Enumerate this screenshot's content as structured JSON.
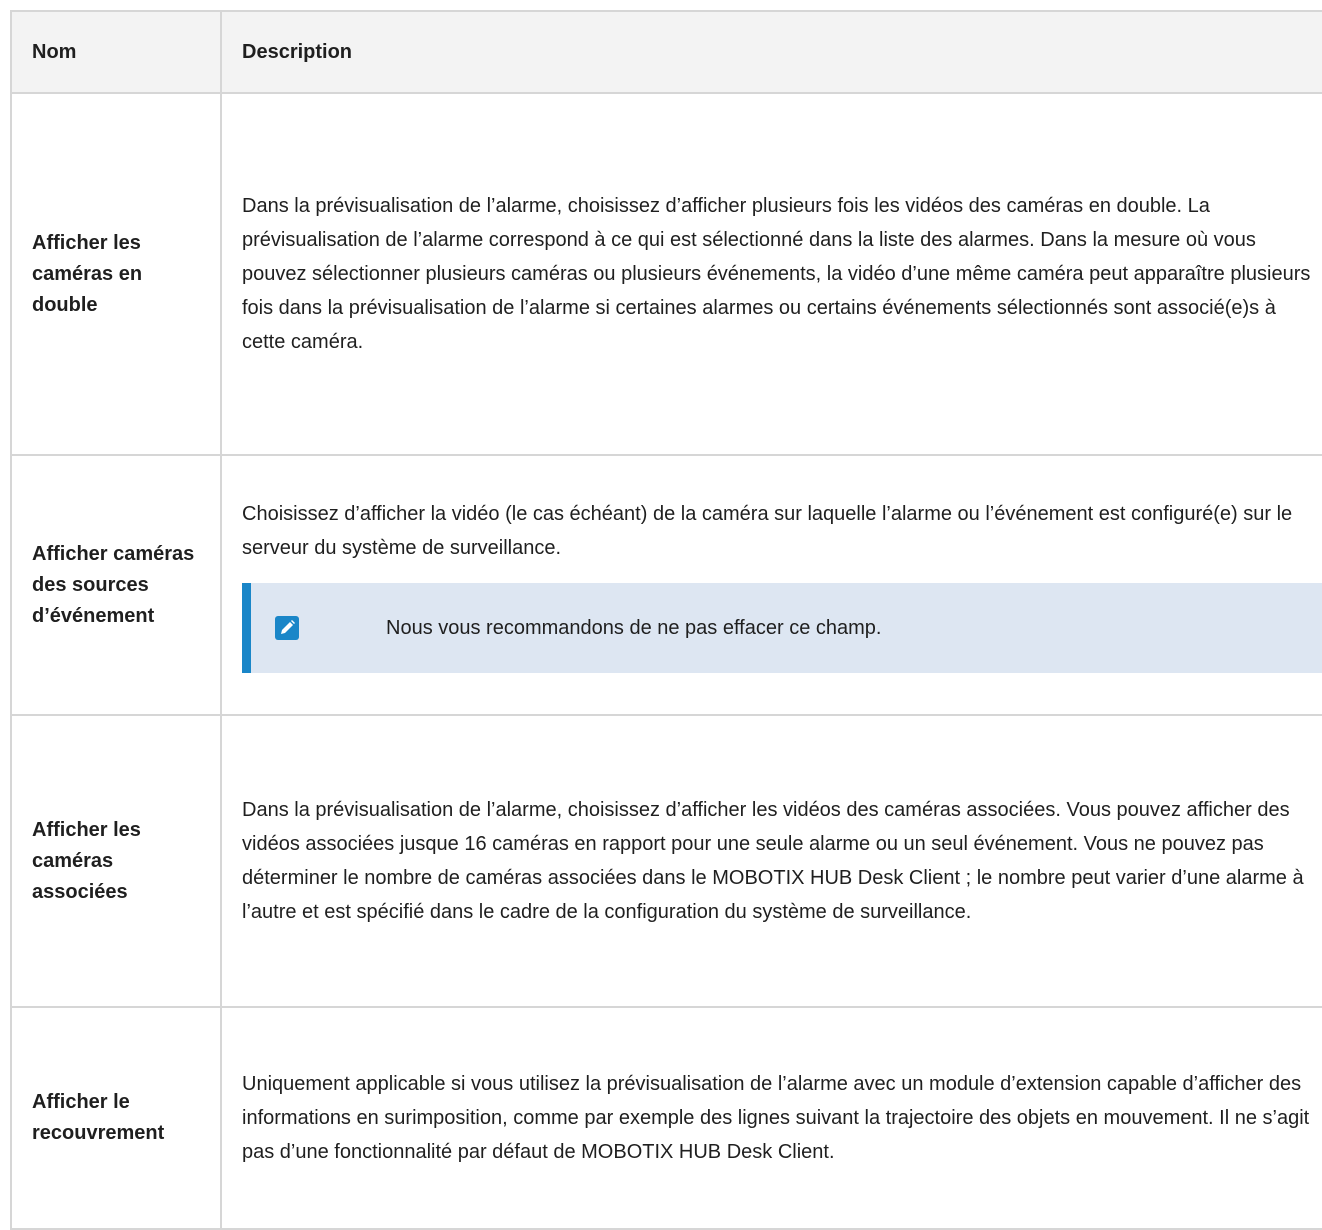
{
  "table": {
    "headers": {
      "name": "Nom",
      "description": "Description"
    },
    "rows": [
      {
        "name": "Afficher les caméras en double",
        "description": "Dans la prévisualisation de l’alarme, choisissez d’afficher plusieurs fois les vidéos des caméras en double. La prévisualisation de l’alarme correspond à ce qui est sélectionné dans la liste des alarmes. Dans la mesure où vous pouvez sélectionner plusieurs caméras ou plusieurs événements, la vidéo d’une même caméra peut apparaître plusieurs fois dans la prévisualisation de l’alarme si certaines alarmes ou certains événements sélectionnés sont associé(e)s à cette caméra."
      },
      {
        "name": "Afficher caméras des sources d’événement",
        "description": "Choisissez d’afficher la vidéo (le cas échéant) de la caméra sur laquelle l’alarme ou l’événement est configuré(e) sur le serveur du système de surveillance.",
        "note": {
          "icon": "pencil-icon",
          "text": "Nous vous recommandons de ne pas effacer ce champ."
        }
      },
      {
        "name": "Afficher les caméras associées",
        "description": "Dans la prévisualisation de l’alarme, choisissez d’afficher les vidéos des caméras associées. Vous pouvez afficher des vidéos associées jusque 16 caméras en rapport pour une seule alarme ou un seul événement. Vous ne pouvez pas déterminer le nombre de caméras associées dans le MOBOTIX HUB Desk Client ; le nombre peut varier d’une alarme à l’autre et est spécifié dans le cadre de la configuration du système de surveillance."
      },
      {
        "name": "Afficher le recouvrement",
        "description": "Uniquement applicable si vous utilisez la prévisualisation de l’alarme avec un module d’extension capable d’afficher des informations en surimposition, comme par exemple des lignes suivant la trajectoire des objets en mouvement. Il ne s’agit pas d’une fonctionnalité par défaut de MOBOTIX HUB Desk Client."
      }
    ]
  },
  "colors": {
    "header_bg": "#f3f3f3",
    "border": "#d6d6d6",
    "note_bg": "#dde6f2",
    "note_accent": "#1a86c8"
  }
}
